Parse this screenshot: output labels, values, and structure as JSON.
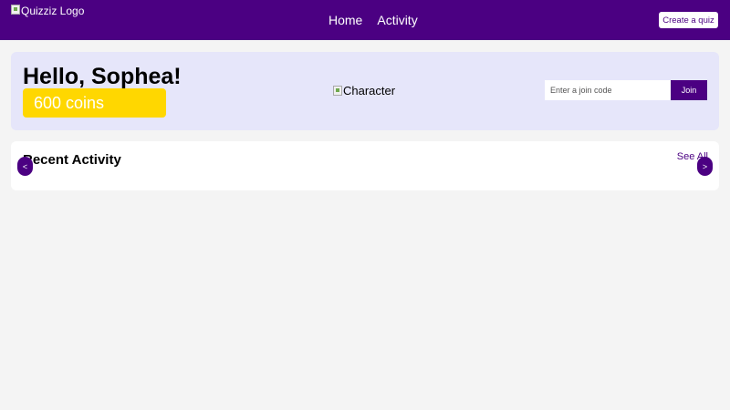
{
  "header": {
    "logo_alt": "Quizziz Logo",
    "nav": [
      {
        "label": "Home"
      },
      {
        "label": "Activity"
      }
    ],
    "create_label": "Create a quiz"
  },
  "hero": {
    "greeting": "Hello, Sophea!",
    "coins": "600 coins",
    "character_alt": "Character",
    "join": {
      "placeholder": "Enter a join code",
      "value": "",
      "button_label": "Join"
    }
  },
  "recent": {
    "title": "Recent Activity",
    "see_all": "See All",
    "prev_label": "<",
    "next_label": ">"
  },
  "colors": {
    "brand": "#4b0082",
    "coins": "#ffd700",
    "hero_bg": "#e6e6fa",
    "page_bg": "#f4f4f4"
  }
}
